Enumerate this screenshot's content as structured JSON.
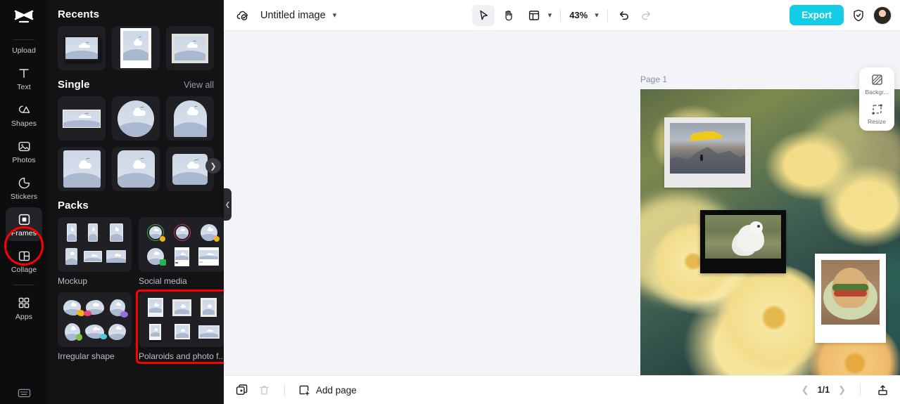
{
  "rail": {
    "logo_icon": "capcut-logo-icon",
    "items": [
      {
        "label": "Upload",
        "icon": "upload-icon",
        "active": false
      },
      {
        "label": "Text",
        "icon": "text-icon",
        "active": false
      },
      {
        "label": "Shapes",
        "icon": "shapes-icon",
        "active": false
      },
      {
        "label": "Photos",
        "icon": "photos-icon",
        "active": false
      },
      {
        "label": "Stickers",
        "icon": "stickers-icon",
        "active": false
      },
      {
        "label": "Frames",
        "icon": "frames-icon",
        "active": true
      },
      {
        "label": "Collage",
        "icon": "collage-icon",
        "active": false
      },
      {
        "label": "Apps",
        "icon": "apps-icon",
        "active": false
      }
    ],
    "bottom_icon": "keyboard-icon",
    "highlight_color": "#ff0000",
    "highlighted_item": "Frames"
  },
  "panel": {
    "recents": {
      "title": "Recents",
      "thumbs": [
        "dark-shadow-frame",
        "polaroid-portrait-frame",
        "mat-border-frame"
      ]
    },
    "single": {
      "title": "Single",
      "view_all": "View all",
      "thumbs": [
        "thin-rect-frame",
        "circle-frame",
        "arch-frame",
        "square-rounded-frame",
        "rounded-corner-frame",
        "soft-square-frame"
      ],
      "next_arrow": "chevron-right-icon"
    },
    "packs_title": "Packs",
    "packs": [
      {
        "label": "Mockup",
        "highlighted": false
      },
      {
        "label": "Social media",
        "highlighted": false
      },
      {
        "label": "Irregular shape",
        "highlighted": false
      },
      {
        "label": "Polaroids and photo f...",
        "highlighted": true
      }
    ],
    "collapse_icon": "chevron-left-icon"
  },
  "topbar": {
    "cloud_icon": "cloud-saved-icon",
    "doc_title": "Untitled image",
    "title_chevron": "chevron-down-icon",
    "tools": [
      {
        "name": "select-tool",
        "icon": "cursor-icon",
        "active": true
      },
      {
        "name": "hand-tool",
        "icon": "hand-icon",
        "active": false
      },
      {
        "name": "layout-tool",
        "icon": "layout-icon",
        "active": false
      }
    ],
    "layout_chevron": "chevron-down-icon",
    "zoom": "43%",
    "zoom_chevron": "chevron-down-icon",
    "undo_icon": "undo-icon",
    "redo_icon": "redo-icon",
    "export_label": "Export",
    "shield_icon": "shield-check-icon",
    "avatar": "user-avatar",
    "export_color": "#13cde6"
  },
  "canvas": {
    "page_label": "Page 1",
    "frames": [
      {
        "name": "paraglider-polaroid",
        "photo": "paraglider-over-mountains"
      },
      {
        "name": "puppy-black-frame",
        "photo": "white-puppy-on-grass"
      },
      {
        "name": "burger-polaroid",
        "photo": "veggie-burger-on-plate"
      }
    ],
    "background_photo": "blurred-yellow-cosmos-flowers"
  },
  "float_panel": {
    "items": [
      {
        "label": "Backgr...",
        "icon": "background-icon"
      },
      {
        "label": "Resize",
        "icon": "resize-icon"
      }
    ]
  },
  "bottombar": {
    "duplicate_icon": "duplicate-page-icon",
    "delete_icon": "trash-icon",
    "add_page_icon": "add-page-icon",
    "add_page_label": "Add page",
    "prev_icon": "chevron-left-icon",
    "page_indicator": "1/1",
    "next_icon": "chevron-right-icon",
    "export_icon": "export-tray-icon"
  }
}
